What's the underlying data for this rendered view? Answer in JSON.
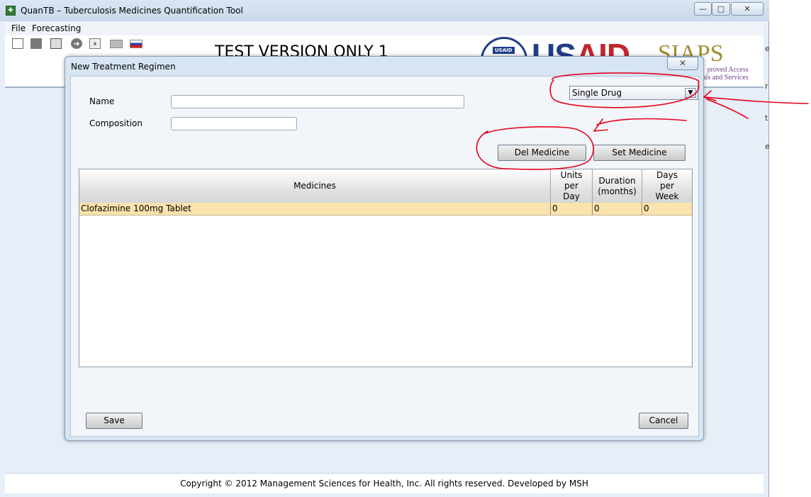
{
  "window": {
    "title": "QuanTB – Tuberculosis Medicines Quantification Tool",
    "controls": {
      "minimize": "—",
      "maximize": "□",
      "close": "✕"
    }
  },
  "menu": {
    "items": [
      "File",
      "Forecasting"
    ]
  },
  "toolbar": {
    "icons": [
      "new-file-icon",
      "open-folder-icon",
      "save-icon",
      "go-arrow-icon",
      "excel-icon",
      "uk-flag-icon",
      "russia-flag-icon"
    ]
  },
  "banner": {
    "version_text": "TEST VERSION ONLY 1",
    "usaid_seal_text": "USAID",
    "usaid_us": "US",
    "usaid_aid": "AID",
    "siaps": "SIAPS",
    "siaps_sub_1": "proved Access",
    "siaps_sub_2": "icals and Services"
  },
  "side_chars": [
    "e",
    "r",
    "t",
    "e"
  ],
  "dialog": {
    "title": "New Treatment Regimen",
    "close_glyph": "✕",
    "name_label": "Name",
    "name_value": "",
    "composition_label": "Composition",
    "composition_value": "",
    "regimen_type": "Single Drug",
    "del_medicine": "Del Medicine",
    "set_medicine": "Set Medicine",
    "table": {
      "columns": [
        {
          "label": "Medicines"
        },
        {
          "label": "Units per Day"
        },
        {
          "label": "Duration (months)"
        },
        {
          "label": "Days per Week"
        }
      ],
      "rows": [
        {
          "medicine": "Clofazimine  100mg  Tablet",
          "units_per_day": "0",
          "duration": "0",
          "days_per_week": "0"
        }
      ]
    },
    "save": "Save",
    "cancel": "Cancel"
  },
  "footer": {
    "copyright": "Copyright © 2012 Management Sciences for Health, Inc. All rights reserved. Developed by MSH"
  },
  "colors": {
    "selected_row": "#fbe3ad",
    "annotation": "#e8001c",
    "usaid_blue": "#1f3e8a",
    "usaid_red": "#c0272d"
  }
}
